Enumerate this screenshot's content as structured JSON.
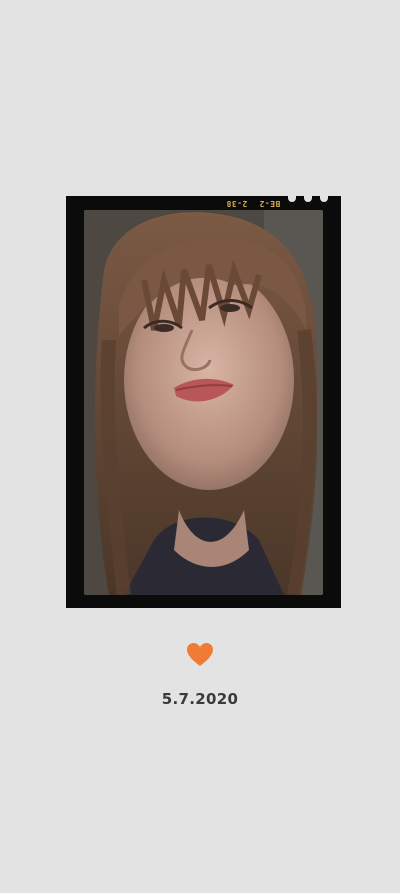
{
  "colors": {
    "background": "#e3e3e3",
    "frame": "#0b0b0b",
    "accent": "#f07b34",
    "edge_text": "#d9b24a",
    "date_text": "#3a3a3a"
  },
  "film": {
    "code_a": "2-38",
    "code_b": "BE-2",
    "edge_mark": ""
  },
  "icons": {
    "heart": "heart-icon"
  },
  "caption": {
    "date": "5.7.2020"
  }
}
